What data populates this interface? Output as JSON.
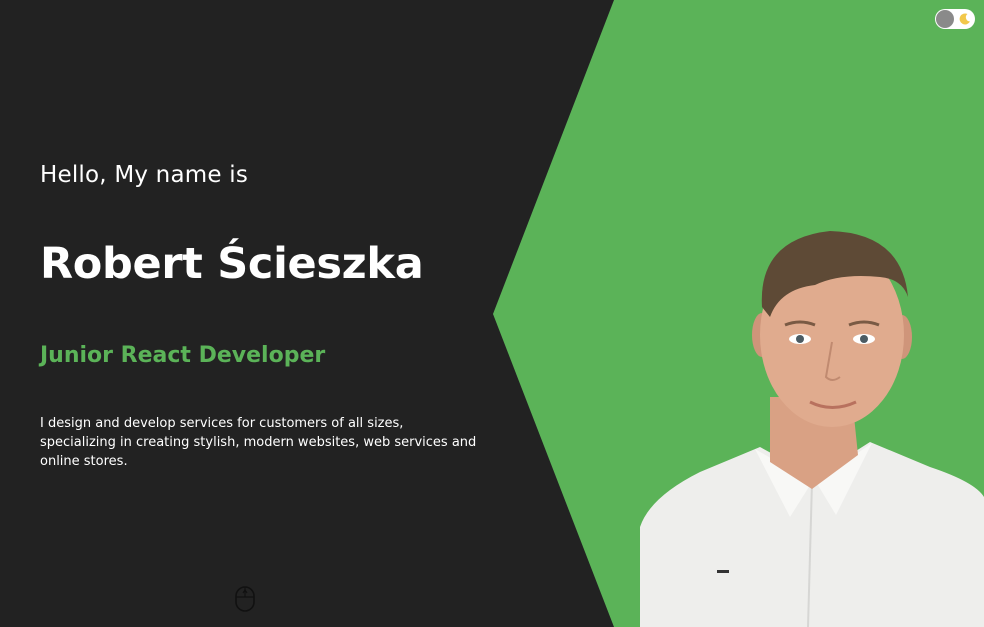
{
  "hero": {
    "greeting": "Hello, My name is",
    "name": "Robert Ścieszka",
    "role": "Junior React Developer",
    "intro": "I design and develop services for customers of all sizes, specializing in creating stylish, modern websites, web services and online stores."
  },
  "colors": {
    "background": "#222222",
    "accent": "#5bb358",
    "text": "#ffffff"
  },
  "icons": {
    "scroll": "mouse-scroll-icon",
    "theme": "moon-icon"
  }
}
